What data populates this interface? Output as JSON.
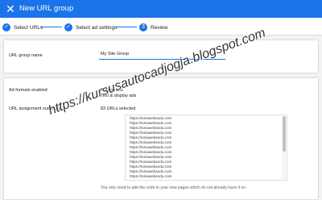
{
  "header": {
    "close_icon": "close-icon",
    "close_glyph": "✕",
    "title": "New URL group"
  },
  "stepper": {
    "steps": [
      {
        "label": "Select URLs",
        "state": "complete",
        "icon": "check-icon",
        "glyph": "✓"
      },
      {
        "label": "Select ad settings",
        "state": "complete",
        "icon": "check-icon",
        "glyph": "✓"
      },
      {
        "label": "Review",
        "state": "current",
        "glyph": "3"
      }
    ]
  },
  "group_name": {
    "label": "URL group name",
    "value": "My Site Group"
  },
  "review": {
    "ad_formats_label": "Ad formats enabled",
    "ad_formats": [
      "Anchor ads",
      "Text & display ads"
    ],
    "summary_label": "URL assignment summary",
    "urls_selected": "83 URLs selected",
    "urls": [
      "https://toniawebandu.com",
      "https://toniawebandu.com",
      "https://toniawebandu.com",
      "https://toniawebandu.com",
      "https://toniawebandu.com",
      "https://toniawebandu.com",
      "https://toniawebandu.com",
      "https://toniawebandu.com",
      "https://toniawebandu.com",
      "https://toniawebandu.com",
      "https://toniawebandu.com",
      "https://toniawebandu.com",
      "https://toniawebandu.com"
    ],
    "footnote": "You only need to add the code to your new pages which do not already have it on."
  },
  "watermark": "https://kursusautocadjogja.blogspot.com",
  "colors": {
    "primary": "#1a73e8",
    "background": "#f1f3f4",
    "border": "#dadce0"
  }
}
